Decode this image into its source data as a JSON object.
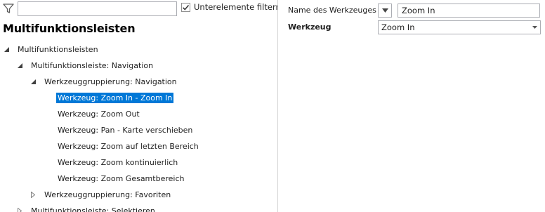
{
  "filter": {
    "icon": "filter-icon",
    "search_value": "",
    "sub_elements_checked": true,
    "sub_elements_label": "Unterelemente filtern"
  },
  "heading": "Multifunktionsleisten",
  "tree": [
    {
      "label": "Multifunktionsleisten",
      "level": 0,
      "state": "expanded",
      "selected": false
    },
    {
      "label": "Multifunktionsleiste: Navigation",
      "level": 1,
      "state": "expanded",
      "selected": false
    },
    {
      "label": "Werkzeuggruppierung: Navigation",
      "level": 2,
      "state": "expanded",
      "selected": false
    },
    {
      "label": "Werkzeug: Zoom In - Zoom In",
      "level": 3,
      "state": "leaf",
      "selected": true
    },
    {
      "label": "Werkzeug: Zoom Out",
      "level": 3,
      "state": "leaf",
      "selected": false
    },
    {
      "label": "Werkzeug: Pan - Karte verschieben",
      "level": 3,
      "state": "leaf",
      "selected": false
    },
    {
      "label": "Werkzeug: Zoom auf letzten Bereich",
      "level": 3,
      "state": "leaf",
      "selected": false
    },
    {
      "label": "Werkzeug: Zoom kontinuierlich",
      "level": 3,
      "state": "leaf",
      "selected": false
    },
    {
      "label": "Werkzeug: Zoom Gesamtbereich",
      "level": 3,
      "state": "leaf",
      "selected": false
    },
    {
      "label": "Werkzeuggruppierung: Favoriten",
      "level": 2,
      "state": "collapsed",
      "selected": false
    },
    {
      "label": "Multifunktionsleiste: Selektieren",
      "level": 1,
      "state": "collapsed",
      "selected": false
    }
  ],
  "properties": {
    "name_label": "Name des Werkzeuges",
    "name_value": "Zoom In",
    "tool_label": "Werkzeug",
    "tool_value": "Zoom In"
  },
  "colors": {
    "selection": "#0078d7",
    "border": "#abadb3",
    "divider": "#d4d4d4"
  }
}
